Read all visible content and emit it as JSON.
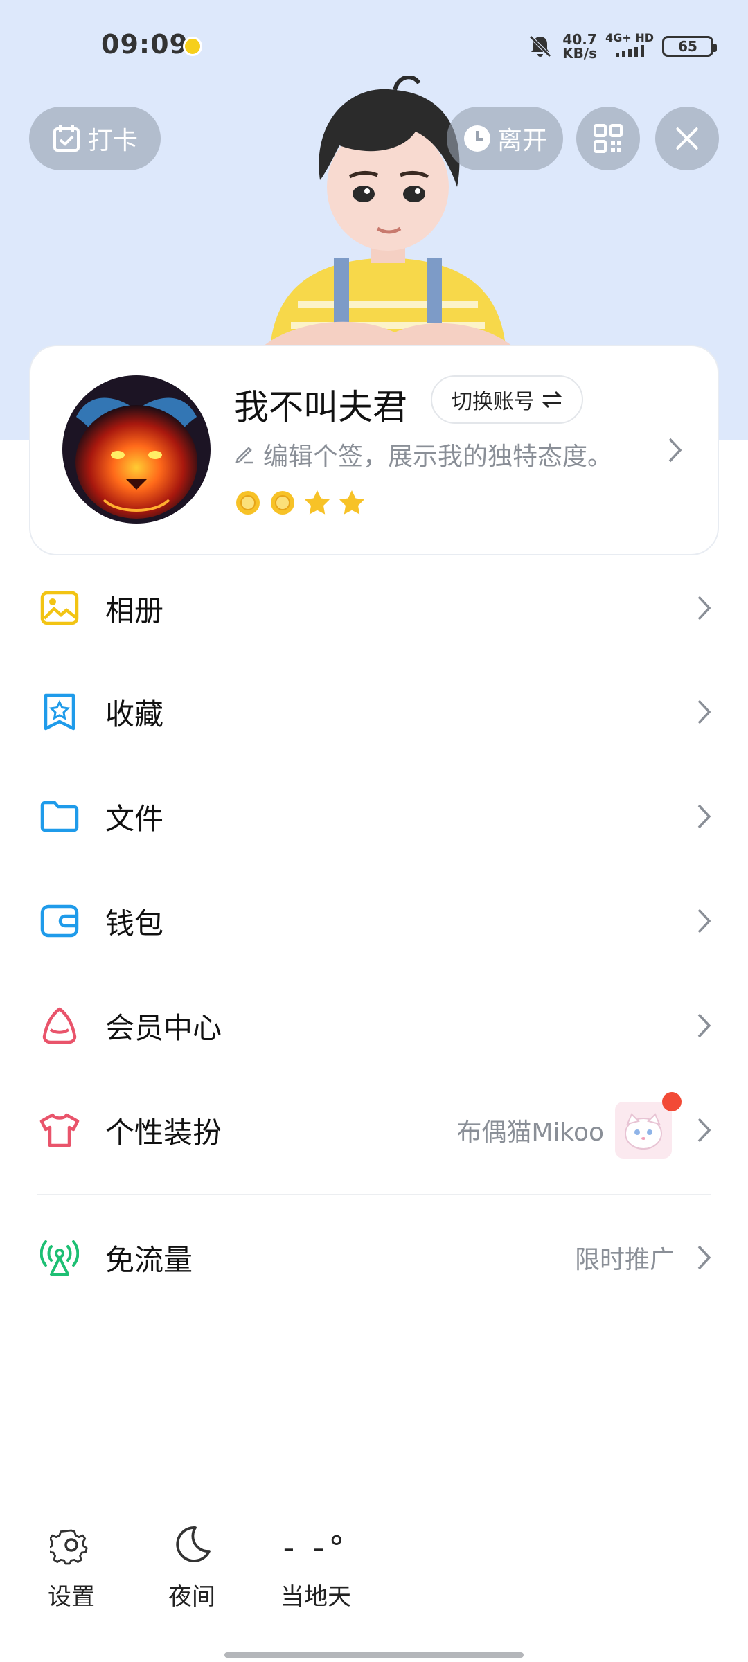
{
  "status_bar": {
    "time": "09:09",
    "net_speed_value": "40.7",
    "net_speed_unit": "KB/s",
    "network": "4G+ HD",
    "battery": "65"
  },
  "header": {
    "checkin_label": "打卡",
    "leave_label": "离开"
  },
  "profile": {
    "nickname": "我不叫夫君",
    "switch_account_label": "切换账号",
    "signature_placeholder": "编辑个签，展示我的独特态度。",
    "level_icons": [
      "sun",
      "sun",
      "star",
      "star"
    ]
  },
  "menu": {
    "items": [
      {
        "label": "相册",
        "icon": "photo-album-icon"
      },
      {
        "label": "收藏",
        "icon": "favorites-icon"
      },
      {
        "label": "文件",
        "icon": "folder-icon"
      },
      {
        "label": "钱包",
        "icon": "wallet-icon"
      },
      {
        "label": "会员中心",
        "icon": "member-center-icon"
      },
      {
        "label": "个性装扮",
        "icon": "theme-shirt-icon",
        "extra": "布偶猫Mikoo"
      }
    ],
    "free_traffic": {
      "label": "免流量",
      "extra": "限时推广",
      "icon": "free-traffic-icon"
    }
  },
  "bottom_bar": {
    "settings_label": "设置",
    "night_label": "夜间",
    "weather_temp": "- -°",
    "weather_label": "当地天"
  },
  "colors": {
    "header_bg": "#dde8fb",
    "album_icon": "#f2c414",
    "blue_icons": "#1f9bea",
    "red_icons": "#e9546b",
    "green_icon": "#1dbf73",
    "badge_red": "#f24a36"
  }
}
